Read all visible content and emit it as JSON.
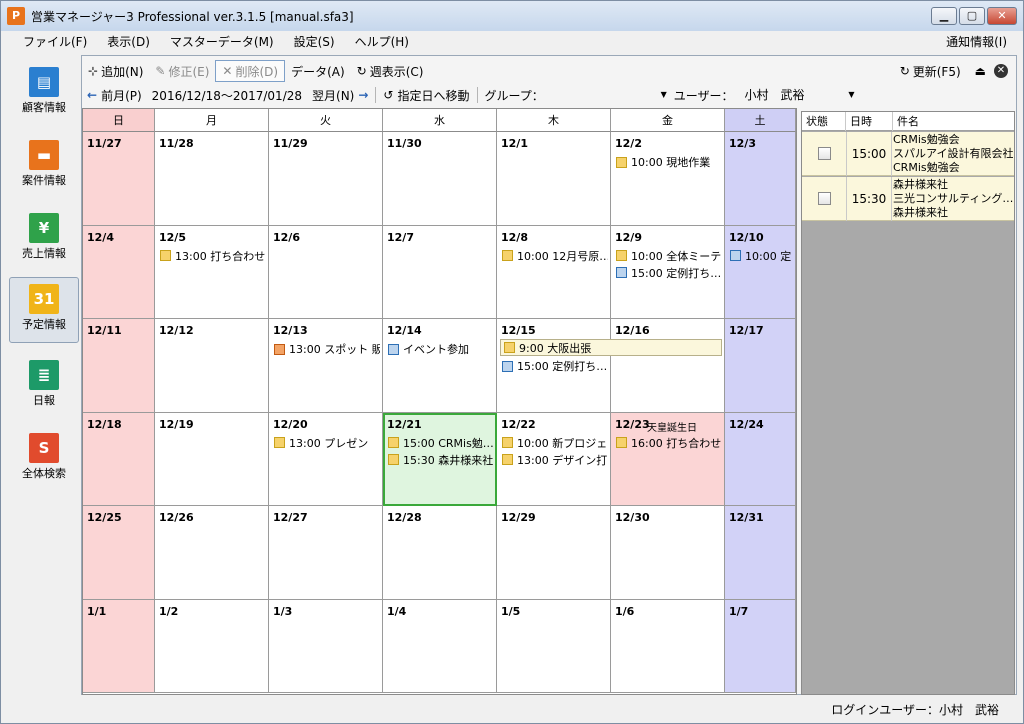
{
  "window": {
    "title": "営業マネージャー3 Professional ver.3.1.5 [manual.sfa3]",
    "app_icon": "P",
    "btn_min": "▁",
    "btn_max": "▢",
    "btn_close": "✕"
  },
  "menu": {
    "items": [
      "ファイル(F)",
      "表示(D)",
      "マスターデータ(M)",
      "設定(S)",
      "ヘルプ(H)"
    ],
    "right": "通知情報(I)"
  },
  "sidebar": {
    "items": [
      {
        "label": "顧客情報",
        "icon": "customer-icon",
        "glyph": "▤",
        "color": "#2a7fd0"
      },
      {
        "label": "案件情報",
        "icon": "deal-icon",
        "glyph": "▬",
        "color": "#e8731c"
      },
      {
        "label": "売上情報",
        "icon": "sales-icon",
        "glyph": "¥",
        "color": "#2fa24a"
      },
      {
        "label": "予定情報",
        "icon": "calendar-icon",
        "glyph": "31",
        "color": "#f0b419"
      },
      {
        "label": "日報",
        "icon": "report-icon",
        "glyph": "≣",
        "color": "#1d9a68"
      },
      {
        "label": "全体検索",
        "icon": "search-icon",
        "glyph": "S",
        "color": "#e14b2d"
      }
    ]
  },
  "toolbar": {
    "add": "追加(N)",
    "edit": "修正(E)",
    "delete": "削除(D)",
    "data": "データ(A)",
    "week": "週表示(C)",
    "refresh": "更新(F5)"
  },
  "nav": {
    "prev": "前月(P)",
    "range": "2016/12/18～2017/01/28",
    "next": "翌月(N)",
    "goto": "指定日へ移動",
    "group_label": "グループ：",
    "group_value": "",
    "user_label": "ユーザー：",
    "user_value": "小村　武裕"
  },
  "calendar": {
    "weekdays": [
      "日",
      "月",
      "火",
      "水",
      "木",
      "金",
      "土"
    ],
    "weeks": [
      [
        "11/27",
        "11/28",
        "11/29",
        "11/30",
        "12/1",
        "12/2",
        "12/3"
      ],
      [
        "12/4",
        "12/5",
        "12/6",
        "12/7",
        "12/8",
        "12/9",
        "12/10"
      ],
      [
        "12/11",
        "12/12",
        "12/13",
        "12/14",
        "12/15",
        "12/16",
        "12/17"
      ],
      [
        "12/18",
        "12/19",
        "12/20",
        "12/21",
        "12/22",
        "12/23",
        "12/24"
      ],
      [
        "12/25",
        "12/26",
        "12/27",
        "12/28",
        "12/29",
        "12/30",
        "12/31"
      ],
      [
        "1/1",
        "1/2",
        "1/3",
        "1/4",
        "1/5",
        "1/6",
        "1/7"
      ]
    ],
    "holidays": [
      {
        "week": 3,
        "day": 5,
        "label": "天皇誕生日"
      }
    ],
    "today": {
      "week": 3,
      "day": 3
    },
    "events": [
      {
        "week": 0,
        "day": 5,
        "slot": 0,
        "icon": "y",
        "text": "10:00 現地作業"
      },
      {
        "week": 1,
        "day": 1,
        "slot": 0,
        "icon": "y",
        "text": "13:00 打ち合わせ"
      },
      {
        "week": 1,
        "day": 4,
        "slot": 0,
        "icon": "y",
        "text": "10:00 12月号原…"
      },
      {
        "week": 1,
        "day": 5,
        "slot": 0,
        "icon": "y",
        "text": "10:00 全体ミーテ…"
      },
      {
        "week": 1,
        "day": 5,
        "slot": 1,
        "icon": "b",
        "text": "15:00 定例打ち…"
      },
      {
        "week": 1,
        "day": 6,
        "slot": 0,
        "icon": "b",
        "text": "10:00 定"
      },
      {
        "week": 2,
        "day": 2,
        "slot": 0,
        "icon": "o",
        "text": "13:00 スポット 販…"
      },
      {
        "week": 2,
        "day": 3,
        "slot": 0,
        "icon": "b",
        "text": "イベント参加"
      },
      {
        "week": 2,
        "day": 4,
        "slot": 1,
        "icon": "b",
        "text": "15:00 定例打ち…"
      },
      {
        "week": 3,
        "day": 2,
        "slot": 0,
        "icon": "y",
        "text": "13:00 プレゼン"
      },
      {
        "week": 3,
        "day": 3,
        "slot": 0,
        "icon": "y",
        "text": "15:00 CRMis勉…"
      },
      {
        "week": 3,
        "day": 3,
        "slot": 1,
        "icon": "y",
        "text": "15:30 森井様来社"
      },
      {
        "week": 3,
        "day": 4,
        "slot": 0,
        "icon": "y",
        "text": "10:00 新プロジェ…"
      },
      {
        "week": 3,
        "day": 4,
        "slot": 1,
        "icon": "y",
        "text": "13:00 デザイン打…"
      },
      {
        "week": 3,
        "day": 5,
        "slot": 0,
        "icon": "y",
        "text": "16:00 打ち合わせ"
      }
    ],
    "span_events": [
      {
        "week": 2,
        "start": 4,
        "end": 5,
        "icon": "y",
        "text": "9:00 大阪出張"
      }
    ]
  },
  "rightpanel": {
    "headers": [
      "状態",
      "日時",
      "件名"
    ],
    "rows": [
      {
        "time": "15:00",
        "subject": [
          "CRMis勉強会",
          "スパルアイ設計有限会社",
          "CRMis勉強会"
        ]
      },
      {
        "time": "15:30",
        "subject": [
          "森井様来社",
          "三光コンサルティング…",
          "森井様来社"
        ]
      }
    ]
  },
  "status": {
    "login": "ログインユーザー：小村　武裕"
  }
}
